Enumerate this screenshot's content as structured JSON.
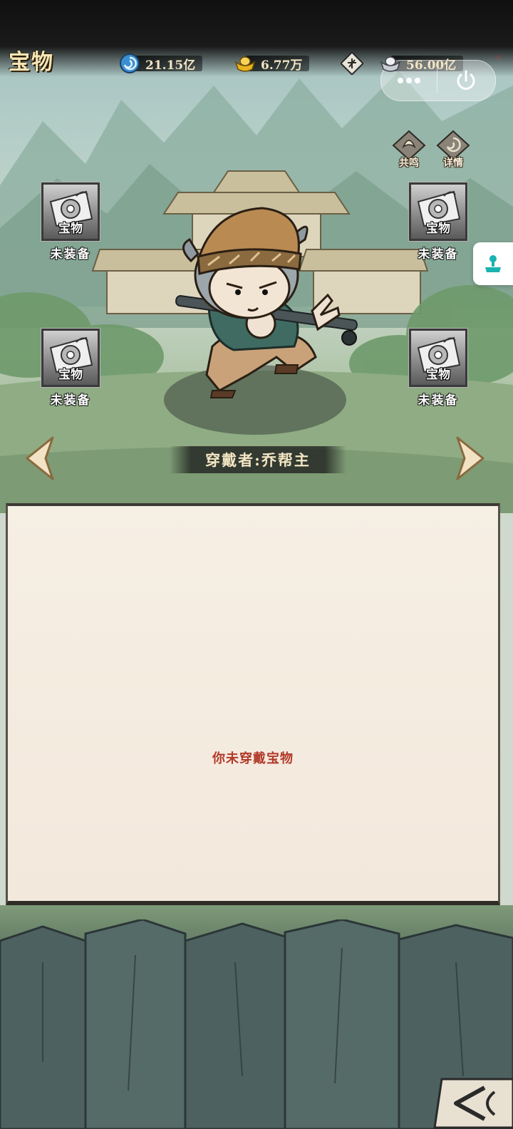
{
  "page": {
    "title": "宝物"
  },
  "currencies": [
    {
      "icon": "swirl-orb-icon",
      "value": "21.15亿"
    },
    {
      "icon": "gold-ingot-icon",
      "value": "6.77万"
    },
    {
      "icon": "coin-icon",
      "value": ""
    },
    {
      "icon": "silver-ingot-icon",
      "value": "56.00亿"
    }
  ],
  "side_buttons": {
    "resonance_label": "共鸣",
    "detail_label": "详情"
  },
  "slots": [
    {
      "label": "宝物",
      "status": "未装备"
    },
    {
      "label": "宝物",
      "status": "未装备"
    },
    {
      "label": "宝物",
      "status": "未装备"
    },
    {
      "label": "宝物",
      "status": "未装备"
    }
  ],
  "wearer": {
    "text": "穿戴者:乔帮主"
  },
  "panel": {
    "empty_message": "你未穿戴宝物"
  },
  "colors": {
    "title_gold": "#f5e6b5",
    "empty_message_red": "#b23a2a",
    "panel_bg": "#f4ebe0"
  }
}
